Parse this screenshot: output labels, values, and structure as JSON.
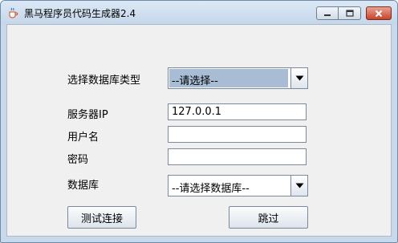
{
  "window": {
    "title": "黑马程序员代码生成器2.4"
  },
  "form": {
    "db_type_label": "选择数据库类型",
    "db_type_value": "--请选择--",
    "server_ip_label": "服务器IP",
    "server_ip_value": "127.0.0.1",
    "username_label": "用户名",
    "username_value": "",
    "password_label": "密码",
    "password_value": "",
    "database_label": "数据库",
    "database_value": "--请选择数据库--"
  },
  "buttons": {
    "test_connection": "测试连接",
    "skip": "跳过"
  },
  "icons": {
    "app": "java-coffee-icon",
    "minimize": "minimize-icon",
    "maximize": "maximize-icon",
    "close": "close-icon",
    "dropdown": "chevron-down-icon"
  }
}
